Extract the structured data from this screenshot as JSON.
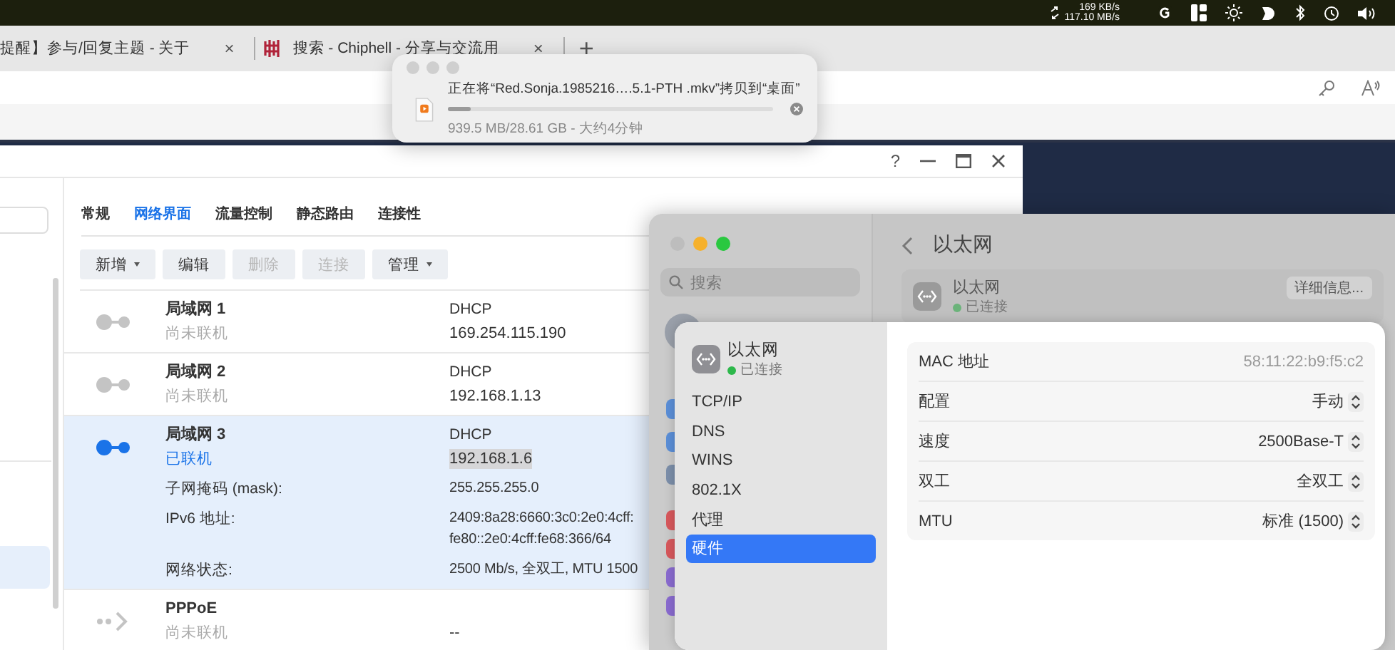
{
  "menu_bar": {
    "upload_speed": "169 KB/s",
    "download_speed": "117.10 MB/s"
  },
  "browser": {
    "tabs": [
      {
        "title": "提醒】参与/回复主题 - 关于",
        "close": "×",
        "selected": false
      },
      {
        "title": "搜索 - Chiphell - 分享与交流用",
        "close": "×",
        "selected": false
      }
    ],
    "new_tab": "+"
  },
  "copy_dialog": {
    "message": "正在将“Red.Sonja.1985216….5.1-PTH .mkv”拷贝到“桌面”",
    "level": 0.07,
    "progress": "939.5 MB/28.61 GB - 大约4分钟"
  },
  "dsm_window": {
    "help": "?",
    "tabs": [
      {
        "label": "常规",
        "selected": false
      },
      {
        "label": "网络界面",
        "selected": true
      },
      {
        "label": "流量控制",
        "selected": false
      },
      {
        "label": "静态路由",
        "selected": false
      },
      {
        "label": "连接性",
        "selected": false
      }
    ],
    "toolbar": [
      {
        "label": "新增",
        "dropdown": true,
        "disabled": false
      },
      {
        "label": "编辑",
        "dropdown": false,
        "disabled": false
      },
      {
        "label": "删除",
        "dropdown": false,
        "disabled": true
      },
      {
        "label": "连接",
        "dropdown": false,
        "disabled": true
      },
      {
        "label": "管理",
        "dropdown": true,
        "disabled": false
      }
    ],
    "interfaces": [
      {
        "kind": "lan",
        "name": "局域网 1",
        "status": "尚未联机",
        "connected": false,
        "selected": false,
        "mode": "DHCP",
        "address": "169.254.115.190",
        "address_highlighted": false
      },
      {
        "kind": "lan",
        "name": "局域网 2",
        "status": "尚未联机",
        "connected": false,
        "selected": false,
        "mode": "DHCP",
        "address": "192.168.1.13",
        "address_highlighted": false
      },
      {
        "kind": "lan",
        "name": "局域网 3",
        "status": "已联机",
        "connected": true,
        "selected": true,
        "mode": "DHCP",
        "address": "192.168.1.6",
        "address_highlighted": true,
        "details": [
          {
            "label": "子网掩码 (mask):",
            "values": [
              "255.255.255.0"
            ]
          },
          {
            "label": "IPv6 地址:",
            "values": [
              "2409:8a28:6660:3c0:2e0:4cff:",
              "fe80::2e0:4cff:fe68:366/64"
            ]
          },
          {
            "label": "网络状态:",
            "values": [
              "2500 Mb/s, 全双工, MTU 1500"
            ]
          }
        ]
      },
      {
        "kind": "pppoe",
        "name": "PPPoE",
        "status": "尚未联机",
        "connected": false,
        "selected": false,
        "address": "--",
        "address_highlighted": false
      }
    ]
  },
  "settings_window": {
    "search_placeholder": "搜索",
    "title": "以太网",
    "card": {
      "name": "以太网",
      "status": "已连接",
      "connected": true,
      "button": "详细信息..."
    },
    "sheet": {
      "name": "以太网",
      "status": "已连接",
      "connected": true,
      "nav": [
        {
          "label": "TCP/IP",
          "selected": false
        },
        {
          "label": "DNS",
          "selected": false
        },
        {
          "label": "WINS",
          "selected": false
        },
        {
          "label": "802.1X",
          "selected": false
        },
        {
          "label": "代理",
          "selected": false
        },
        {
          "label": "硬件",
          "selected": true
        }
      ],
      "rows": [
        {
          "kind": "text",
          "label": "MAC 地址",
          "value": "58:11:22:b9:f5:c2"
        },
        {
          "kind": "popup",
          "label": "配置",
          "value": "手动"
        },
        {
          "kind": "popup",
          "label": "速度",
          "value": "2500Base-T"
        },
        {
          "kind": "popup",
          "label": "双工",
          "value": "全双工"
        },
        {
          "kind": "popup",
          "label": "MTU",
          "value": "标准 (1500)"
        }
      ]
    }
  }
}
